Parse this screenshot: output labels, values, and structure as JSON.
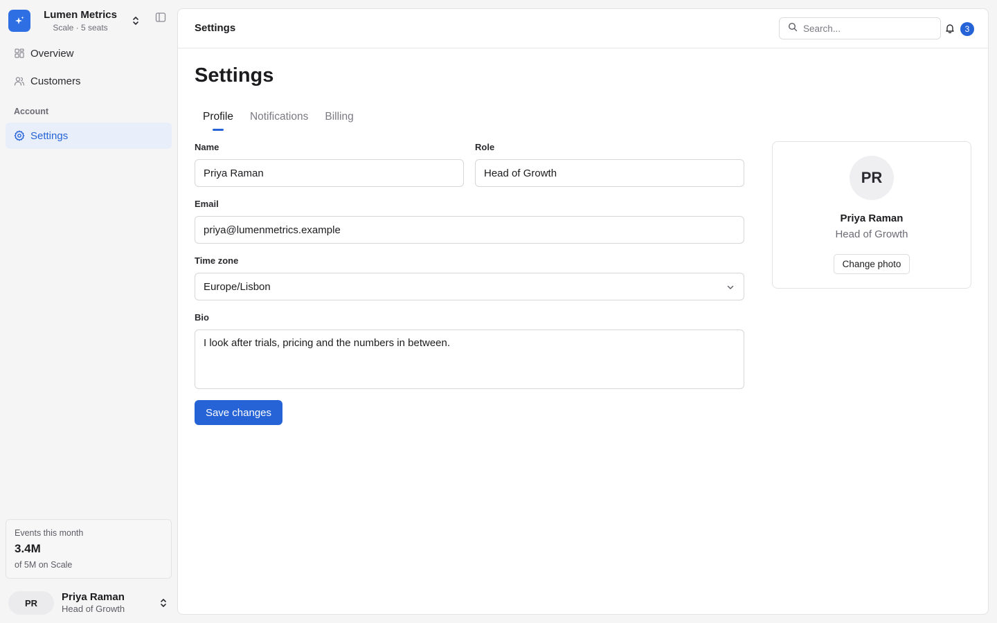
{
  "workspace": {
    "name": "Lumen Metrics",
    "plan": "Scale · 5 seats"
  },
  "sidebar": {
    "items": [
      {
        "label": "Overview",
        "icon": "grid-icon"
      },
      {
        "label": "Customers",
        "icon": "users-icon"
      }
    ],
    "section_label": "Account",
    "active_item": {
      "label": "Settings",
      "icon": "gear-icon"
    },
    "usage": {
      "label": "Events this month",
      "value": "3.4M",
      "sub": "of 5M on Scale"
    },
    "user": {
      "initials": "PR",
      "name": "Priya Raman",
      "role": "Head of Growth"
    }
  },
  "header": {
    "title": "Settings",
    "search_placeholder": "Search...",
    "notification_count": "3"
  },
  "page": {
    "title": "Settings",
    "tabs": [
      {
        "label": "Profile",
        "active": true
      },
      {
        "label": "Notifications",
        "active": false
      },
      {
        "label": "Billing",
        "active": false
      }
    ]
  },
  "form": {
    "name": {
      "label": "Name",
      "value": "Priya Raman"
    },
    "role": {
      "label": "Role",
      "value": "Head of Growth"
    },
    "email": {
      "label": "Email",
      "value": "priya@lumenmetrics.example"
    },
    "timezone": {
      "label": "Time zone",
      "value": "Europe/Lisbon"
    },
    "bio": {
      "label": "Bio",
      "value": "I look after trials, pricing and the numbers in between."
    },
    "save_label": "Save changes"
  },
  "profile_card": {
    "initials": "PR",
    "name": "Priya Raman",
    "role": "Head of Growth",
    "change_photo_label": "Change photo"
  },
  "colors": {
    "accent": "#2563d6",
    "logo": "#2f6fe4"
  }
}
